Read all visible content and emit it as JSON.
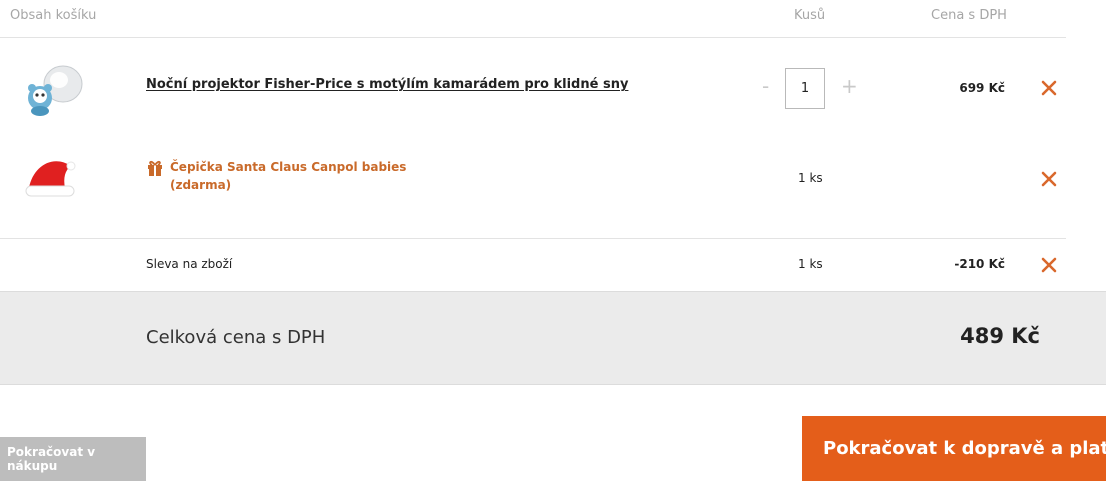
{
  "header": {
    "col_content": "Obsah košíku",
    "col_qty": "Kusů",
    "col_price": "Cena s DPH"
  },
  "items": [
    {
      "name": "Noční projektor Fisher-Price s motýlím kamarádem pro klidné sny",
      "quantity": "1",
      "price": "699 Kč",
      "minus": "-",
      "plus": "+"
    }
  ],
  "gift": {
    "name_line1": "Čepička Santa Claus Canpol babies",
    "name_line2": "(zdarma)",
    "qty": "1 ks"
  },
  "discount": {
    "label": "Sleva na zboží",
    "qty": "1 ks",
    "price": "-210 Kč"
  },
  "total": {
    "label": "Celková cena s DPH",
    "value": "489 Kč"
  },
  "buttons": {
    "back": "Pokračovat v nákupu",
    "next": "Pokračovat k dopravě a platbě"
  },
  "colors": {
    "accent": "#e45e1a",
    "gift_text": "#c96a2a",
    "delete_icon": "#d9682c"
  },
  "icons": {
    "delete": "close-icon",
    "gift": "gift-icon"
  }
}
